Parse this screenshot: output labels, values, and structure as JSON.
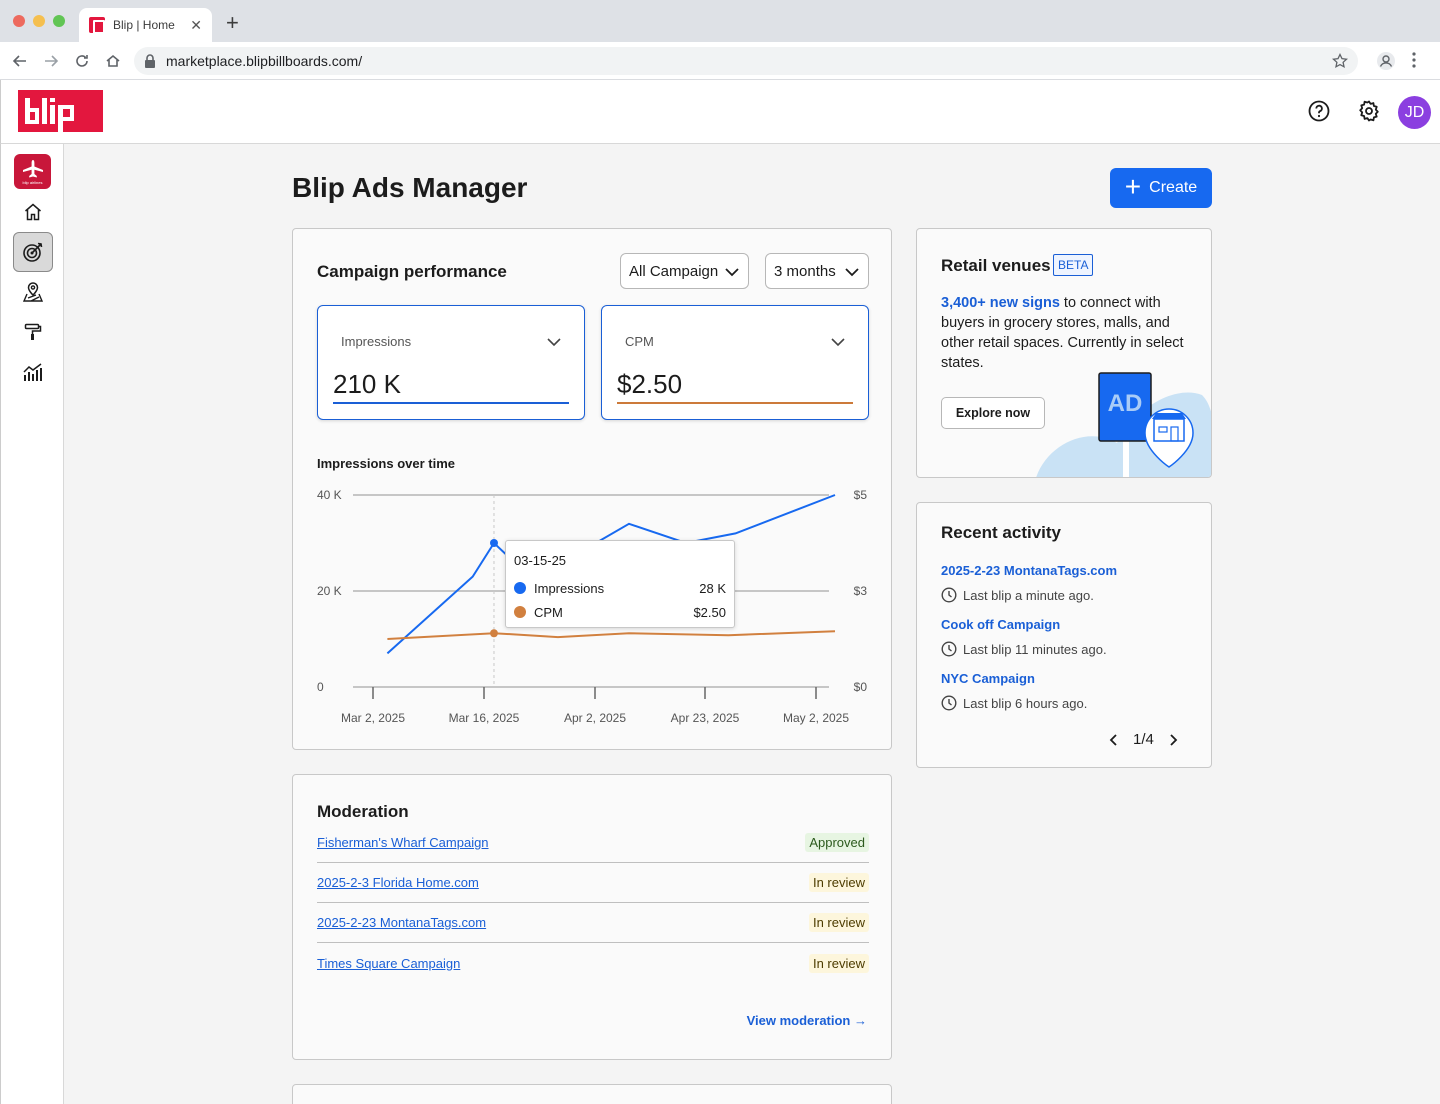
{
  "browser": {
    "tab_title": "Blip | Home",
    "url": "marketplace.blipbillboards.com/"
  },
  "header": {
    "logo_alt": "blip",
    "avatar_initials": "JD"
  },
  "rail": {
    "logo_caption": "blip airlines"
  },
  "page": {
    "title": "Blip Ads Manager",
    "create_label": "Create"
  },
  "performance": {
    "title": "Campaign performance",
    "campaign_filter": "All Campaign",
    "range_filter": "3 months",
    "metrics": [
      {
        "label": "Impressions",
        "value": "210 K",
        "color": "#1a5fd6"
      },
      {
        "label": "CPM",
        "value": "$2.50",
        "color": "#cc7a3a"
      }
    ],
    "chart_title": "Impressions over time"
  },
  "chart_data": {
    "type": "line",
    "title": "Impressions over time",
    "x_ticks": [
      "Mar 2, 2025",
      "Mar 16, 2025",
      "Apr 2, 2025",
      "Apr 23, 2025",
      "May 2, 2025"
    ],
    "y_left_ticks": [
      "0",
      "20 K",
      "40 K"
    ],
    "y_right_ticks": [
      "$0",
      "$3",
      "$5"
    ],
    "ylim_left": [
      0,
      40000
    ],
    "ylim_right": [
      0,
      5
    ],
    "grid": true,
    "series": [
      {
        "name": "Impressions",
        "axis": "left",
        "color": "#1769f0",
        "x": [
          "2025-02-28",
          "2025-03-12",
          "2025-03-15",
          "2025-03-20",
          "2025-03-27",
          "2025-04-03",
          "2025-04-11",
          "2025-04-18",
          "2025-05-02"
        ],
        "values": [
          7000,
          23000,
          30000,
          23000,
          28000,
          34000,
          30000,
          32000,
          40000
        ]
      },
      {
        "name": "CPM",
        "axis": "right",
        "color": "#d1803f",
        "x": [
          "2025-02-28",
          "2025-03-15",
          "2025-03-24",
          "2025-04-03",
          "2025-04-17",
          "2025-05-02"
        ],
        "values": [
          1.25,
          1.4,
          1.3,
          1.4,
          1.35,
          1.45
        ]
      }
    ],
    "highlight": {
      "x": "2025-03-15",
      "label": "03-15-25",
      "rows": [
        {
          "name": "Impressions",
          "value": "28 K",
          "color": "#1769f0"
        },
        {
          "name": "CPM",
          "value": "$2.50",
          "color": "#d1803f"
        }
      ]
    }
  },
  "moderation": {
    "title": "Moderation",
    "rows": [
      {
        "name": "Fisherman's Wharf Campaign",
        "status": "Approved"
      },
      {
        "name": "2025-2-3 Florida Home.com",
        "status": "In review"
      },
      {
        "name": "2025-2-23 MontanaTags.com",
        "status": "In review"
      },
      {
        "name": "Times Square Campaign",
        "status": "In review"
      }
    ],
    "view_label": "View moderation →"
  },
  "retail": {
    "title": "Retail venues",
    "badge": "BETA",
    "highlight": "3,400+ new signs",
    "body": " to connect with buyers in grocery stores, malls, and other retail spaces. Currently in select states.",
    "button": "Explore now",
    "art_text": "AD"
  },
  "recent": {
    "title": "Recent activity",
    "items": [
      {
        "name": "2025-2-23 MontanaTags.com",
        "time": "Last blip a minute ago."
      },
      {
        "name": "Cook off Campaign",
        "time": "Last blip 11 minutes ago."
      },
      {
        "name": "NYC Campaign",
        "time": "Last blip 6 hours ago."
      }
    ],
    "page": "1/4"
  }
}
